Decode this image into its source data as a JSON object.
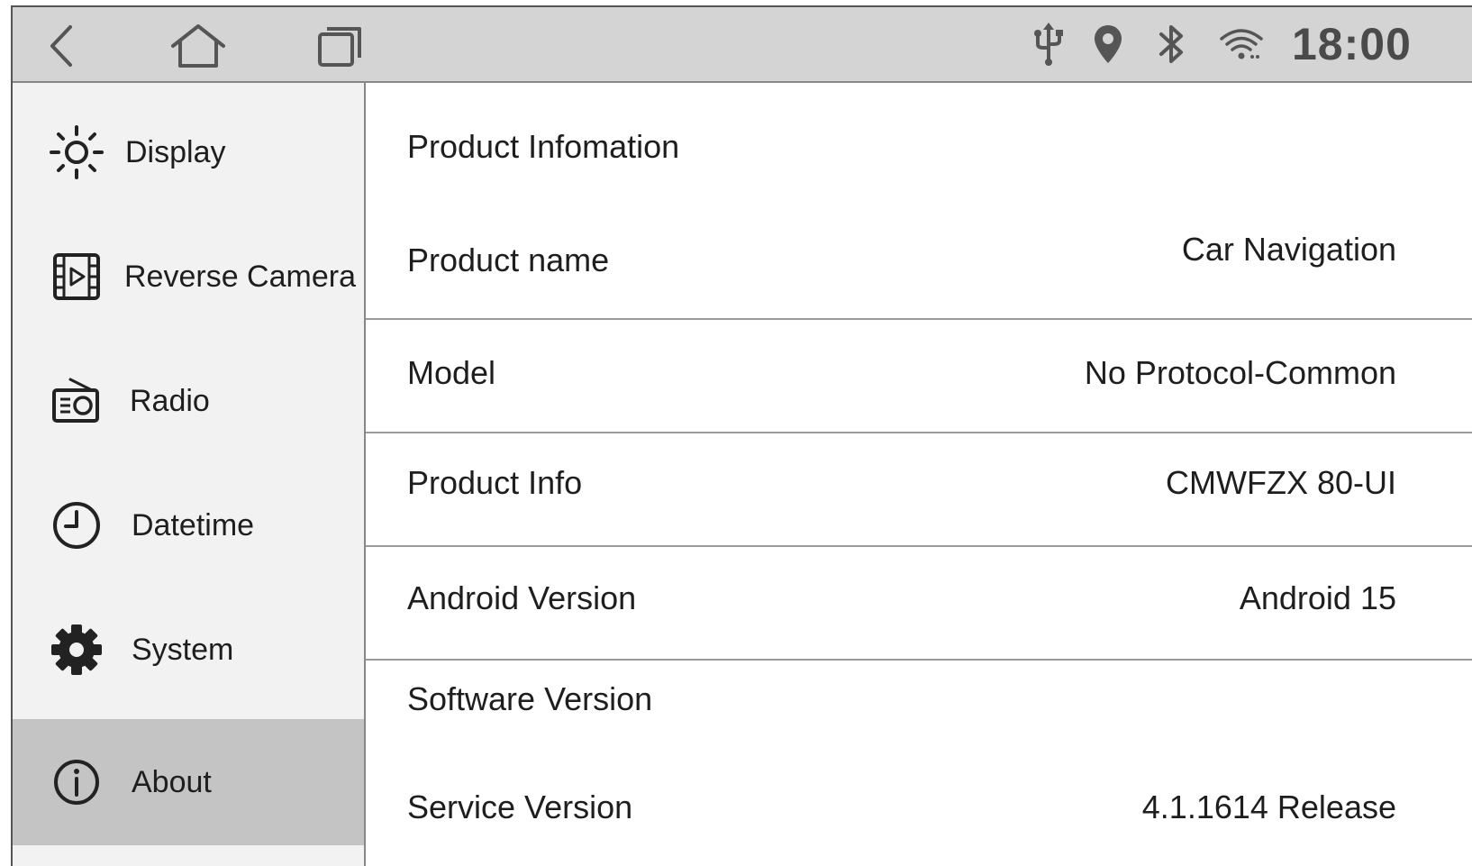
{
  "status_bar": {
    "time": "18:00",
    "icons": [
      "back-icon",
      "home-icon",
      "recent-apps-icon",
      "usb-icon",
      "location-icon",
      "bluetooth-icon",
      "wifi-icon"
    ]
  },
  "sidebar": {
    "items": [
      {
        "label": "Display",
        "icon": "sun-icon"
      },
      {
        "label": "Reverse Camera",
        "icon": "film-play-icon"
      },
      {
        "label": "Radio",
        "icon": "radio-icon"
      },
      {
        "label": "Datetime",
        "icon": "clock-icon"
      },
      {
        "label": "System",
        "icon": "gear-icon"
      },
      {
        "label": "About",
        "icon": "info-icon"
      }
    ],
    "active": "About"
  },
  "content": {
    "section_title": "Product Infomation",
    "rows": [
      {
        "label": "Product name",
        "value": "Car Navigation"
      },
      {
        "label": "Model",
        "value": "No Protocol-Common"
      },
      {
        "label": "Product Info",
        "value": "CMWFZX 80-UI"
      },
      {
        "label": "Android Version",
        "value": "Android 15"
      },
      {
        "label": "Software Version",
        "value": ""
      },
      {
        "label": "Service Version",
        "value": "4.1.1614 Release"
      }
    ]
  },
  "colors": {
    "status_bar_bg": "#d4d4d4",
    "sidebar_bg": "#f2f2f2",
    "active_item_bg": "#c4c4c4",
    "icon_color": "#555555"
  }
}
